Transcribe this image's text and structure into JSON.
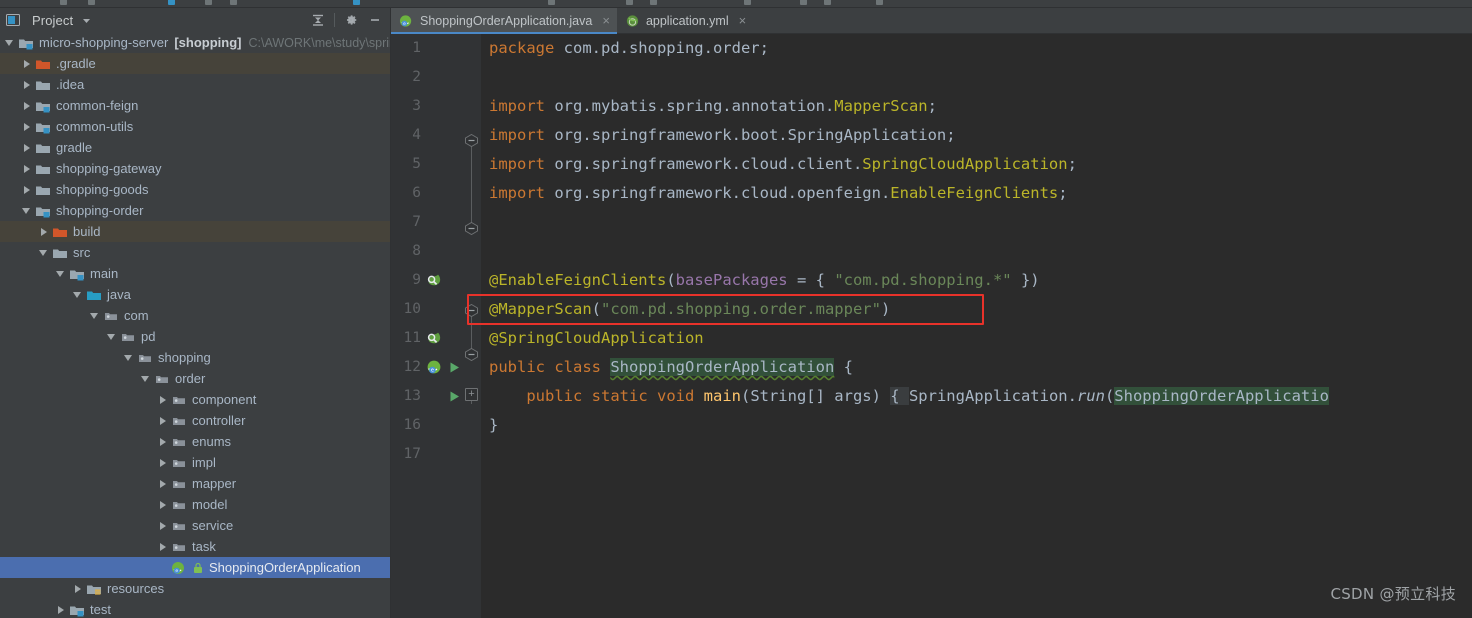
{
  "window": {
    "watermark": "CSDN @预立科技"
  },
  "project_panel": {
    "title": "Project",
    "title_dropdown_icon": "chevron-down-icon",
    "toolbar": [
      {
        "name": "collapse-all-icon",
        "label": "collapse-all-icon"
      },
      {
        "name": "gear-icon",
        "label": "gear-icon"
      },
      {
        "name": "minimize-icon",
        "label": "minimize-icon"
      }
    ],
    "tree": [
      {
        "label": "micro-shopping-server",
        "badge": "[shopping]",
        "path": "C:\\AWORK\\me\\study\\sprin",
        "indent": 0,
        "arrow": "down",
        "icon": "module-folder-icon",
        "state": "normal"
      },
      {
        "label": ".gradle",
        "indent": 1,
        "arrow": "right",
        "icon": "excluded-folder-icon",
        "state": "highlight"
      },
      {
        "label": ".idea",
        "indent": 1,
        "arrow": "right",
        "icon": "folder-icon",
        "state": "normal"
      },
      {
        "label": "common-feign",
        "indent": 1,
        "arrow": "right",
        "icon": "module-folder-icon",
        "state": "normal"
      },
      {
        "label": "common-utils",
        "indent": 1,
        "arrow": "right",
        "icon": "module-folder-icon",
        "state": "normal"
      },
      {
        "label": "gradle",
        "indent": 1,
        "arrow": "right",
        "icon": "folder-icon",
        "state": "normal"
      },
      {
        "label": "shopping-gateway",
        "indent": 1,
        "arrow": "right",
        "icon": "folder-icon",
        "state": "normal"
      },
      {
        "label": "shopping-goods",
        "indent": 1,
        "arrow": "right",
        "icon": "folder-icon",
        "state": "normal"
      },
      {
        "label": "shopping-order",
        "indent": 1,
        "arrow": "down",
        "icon": "module-folder-icon",
        "state": "normal"
      },
      {
        "label": "build",
        "indent": 2,
        "arrow": "right",
        "icon": "excluded-folder-icon",
        "state": "highlight"
      },
      {
        "label": "src",
        "indent": 2,
        "arrow": "down",
        "icon": "folder-icon",
        "state": "normal"
      },
      {
        "label": "main",
        "indent": 3,
        "arrow": "down",
        "icon": "module-folder-icon",
        "state": "normal"
      },
      {
        "label": "java",
        "indent": 4,
        "arrow": "down",
        "icon": "source-root-icon",
        "state": "normal"
      },
      {
        "label": "com",
        "indent": 5,
        "arrow": "down",
        "icon": "package-icon",
        "state": "normal"
      },
      {
        "label": "pd",
        "indent": 6,
        "arrow": "down",
        "icon": "package-icon",
        "state": "normal"
      },
      {
        "label": "shopping",
        "indent": 7,
        "arrow": "down",
        "icon": "package-icon",
        "state": "normal"
      },
      {
        "label": "order",
        "indent": 8,
        "arrow": "down",
        "icon": "package-icon",
        "state": "normal"
      },
      {
        "label": "component",
        "indent": 9,
        "arrow": "right",
        "icon": "package-icon",
        "state": "normal"
      },
      {
        "label": "controller",
        "indent": 9,
        "arrow": "right",
        "icon": "package-icon",
        "state": "normal"
      },
      {
        "label": "enums",
        "indent": 9,
        "arrow": "right",
        "icon": "package-icon",
        "state": "normal"
      },
      {
        "label": "impl",
        "indent": 9,
        "arrow": "right",
        "icon": "package-icon",
        "state": "normal"
      },
      {
        "label": "mapper",
        "indent": 9,
        "arrow": "right",
        "icon": "package-icon",
        "state": "normal"
      },
      {
        "label": "model",
        "indent": 9,
        "arrow": "right",
        "icon": "package-icon",
        "state": "normal"
      },
      {
        "label": "service",
        "indent": 9,
        "arrow": "right",
        "icon": "package-icon",
        "state": "normal"
      },
      {
        "label": "task",
        "indent": 9,
        "arrow": "right",
        "icon": "package-icon",
        "state": "normal"
      },
      {
        "label": "ShoppingOrderApplication",
        "indent": 9,
        "arrow": "none",
        "icon": "spring-boot-class-icon",
        "state": "selected"
      },
      {
        "label": "resources",
        "indent": 4,
        "arrow": "right",
        "icon": "resources-root-icon",
        "state": "normal"
      },
      {
        "label": "test",
        "indent": 3,
        "arrow": "right",
        "icon": "module-folder-icon",
        "state": "normal"
      }
    ]
  },
  "editor": {
    "tabs": [
      {
        "label": "ShoppingOrderApplication.java",
        "icon": "spring-boot-class-icon",
        "active": true,
        "close": "×"
      },
      {
        "label": "application.yml",
        "icon": "spring-yaml-icon",
        "active": false,
        "close": "×"
      }
    ],
    "gutter_numbers": [
      "1",
      "2",
      "3",
      "4",
      "5",
      "6",
      "7",
      "8",
      "9",
      "10",
      "11",
      "12",
      "13",
      "16",
      "17"
    ],
    "gutter_icons": [
      {
        "line": 9,
        "icon": "spring-bean-search-icon"
      },
      {
        "line": 11,
        "icon": "spring-bean-search-icon"
      },
      {
        "line": 12,
        "icon": "spring-boot-run-icon"
      },
      {
        "line": 12,
        "icon": "run-triangle-icon"
      },
      {
        "line": 13,
        "icon": "run-triangle-icon"
      }
    ],
    "lines": [
      {
        "n": "1",
        "tokens": [
          {
            "t": "package ",
            "c": "kw"
          },
          {
            "t": "com.pd.shopping.order;",
            "c": "plain"
          }
        ]
      },
      {
        "n": "2",
        "tokens": []
      },
      {
        "n": "3",
        "tokens": [
          {
            "t": "import ",
            "c": "kw"
          },
          {
            "t": "org.mybatis.spring.annotation.",
            "c": "plain"
          },
          {
            "t": "MapperScan",
            "c": "ann"
          },
          {
            "t": ";",
            "c": "plain"
          }
        ]
      },
      {
        "n": "4",
        "tokens": [
          {
            "t": "import ",
            "c": "kw"
          },
          {
            "t": "org.springframework.boot.SpringApplication;",
            "c": "plain"
          }
        ]
      },
      {
        "n": "5",
        "tokens": [
          {
            "t": "import ",
            "c": "kw"
          },
          {
            "t": "org.springframework.cloud.client.",
            "c": "plain"
          },
          {
            "t": "SpringCloudApplication",
            "c": "ann"
          },
          {
            "t": ";",
            "c": "plain"
          }
        ]
      },
      {
        "n": "6",
        "tokens": [
          {
            "t": "import ",
            "c": "kw"
          },
          {
            "t": "org.springframework.cloud.openfeign.",
            "c": "plain"
          },
          {
            "t": "EnableFeignClients",
            "c": "ann"
          },
          {
            "t": ";",
            "c": "plain"
          }
        ]
      },
      {
        "n": "7",
        "tokens": []
      },
      {
        "n": "8",
        "tokens": []
      },
      {
        "n": "9",
        "tokens": [
          {
            "t": "@EnableFeignClients",
            "c": "ann"
          },
          {
            "t": "(",
            "c": "plain"
          },
          {
            "t": "basePackages",
            "c": "param"
          },
          {
            "t": " = { ",
            "c": "plain"
          },
          {
            "t": "\"com.pd.shopping.*\"",
            "c": "str"
          },
          {
            "t": " })",
            "c": "plain"
          }
        ]
      },
      {
        "n": "10",
        "tokens": [
          {
            "t": "@MapperScan",
            "c": "ann"
          },
          {
            "t": "(",
            "c": "plain"
          },
          {
            "t": "\"com.pd.shopping.order.mapper\"",
            "c": "str"
          },
          {
            "t": ")",
            "c": "plain"
          }
        ]
      },
      {
        "n": "11",
        "tokens": [
          {
            "t": "@SpringCloudApplication",
            "c": "ann"
          }
        ]
      },
      {
        "n": "12",
        "tokens": [
          {
            "t": "public ",
            "c": "kw"
          },
          {
            "t": "class ",
            "c": "kw"
          },
          {
            "t": "ShoppingOrderApplication",
            "c": "classhl wavy"
          },
          {
            "t": " {",
            "c": "plain"
          }
        ]
      },
      {
        "n": "13",
        "tokens": [
          {
            "t": "    public ",
            "c": "kw"
          },
          {
            "t": "static ",
            "c": "kw"
          },
          {
            "t": "void ",
            "c": "kw"
          },
          {
            "t": "main",
            "c": "mname"
          },
          {
            "t": "(String[] args) ",
            "c": "plain"
          },
          {
            "t": "{ ",
            "c": "brkhl"
          },
          {
            "t": "SpringApplication.",
            "c": "plain"
          },
          {
            "t": "run",
            "c": "ital"
          },
          {
            "t": "(",
            "c": "plain"
          },
          {
            "t": "ShoppingOrderApplicatio",
            "c": "classhl"
          }
        ]
      },
      {
        "n": "16",
        "tokens": [
          {
            "t": "}",
            "c": "plain"
          }
        ]
      },
      {
        "n": "17",
        "tokens": []
      }
    ],
    "annotation": {
      "type": "red-rectangle",
      "target_line": "10",
      "target_text": "@MapperScan(\"com.pd.shopping.order.mapper\")"
    }
  },
  "colors": {
    "editor_bg": "#2b2b2b",
    "gutter_bg": "#313335",
    "panel_bg": "#3c3f41",
    "selection_blue": "#4b6eaf",
    "annotation_red": "#e8322a",
    "keyword_orange": "#cc7832",
    "string_green": "#6a8759",
    "annotation_yellow": "#bbb529",
    "text_gray": "#a9b7c6"
  }
}
